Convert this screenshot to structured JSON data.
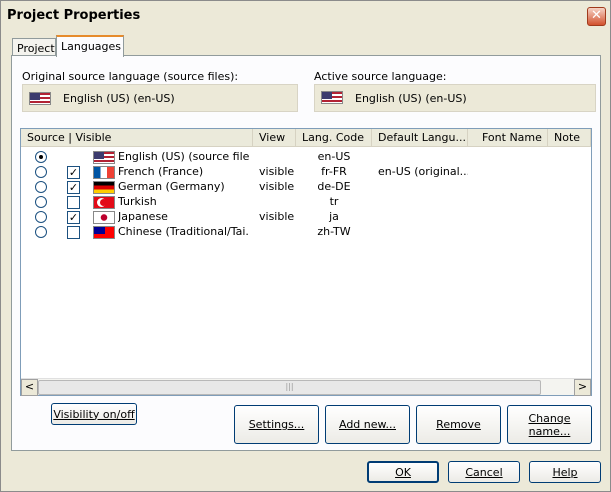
{
  "window": {
    "title": "Project Properties",
    "close": "✕"
  },
  "tabs": [
    {
      "label": "Project"
    },
    {
      "label": "Languages"
    }
  ],
  "original_source": {
    "label": "Original source language (source files):",
    "value": "English (US) (en-US)"
  },
  "active_source": {
    "label": "Active source language:",
    "value": "English (US) (en-US)"
  },
  "list": {
    "columns": [
      "Source | Visible",
      "View",
      "Lang. Code",
      "Default Langu...",
      "Font Name",
      "Note"
    ],
    "rows": [
      {
        "source_selected": true,
        "visible": null,
        "flag": "us",
        "name": "English (US) (source file)",
        "view": "",
        "code": "en-US",
        "default": ""
      },
      {
        "source_selected": false,
        "visible": true,
        "flag": "fr",
        "name": "French (France)",
        "view": "visible",
        "code": "fr-FR",
        "default": "en-US (original..."
      },
      {
        "source_selected": false,
        "visible": true,
        "flag": "de",
        "name": "German (Germany)",
        "view": "visible",
        "code": "de-DE",
        "default": ""
      },
      {
        "source_selected": false,
        "visible": false,
        "flag": "tr",
        "name": "Turkish",
        "view": "",
        "code": "tr",
        "default": ""
      },
      {
        "source_selected": false,
        "visible": true,
        "flag": "jp",
        "name": "Japanese",
        "view": "visible",
        "code": "ja",
        "default": ""
      },
      {
        "source_selected": false,
        "visible": false,
        "flag": "tw",
        "name": "Chinese (Traditional/Tai...",
        "view": "",
        "code": "zh-TW",
        "default": ""
      }
    ],
    "scroll_left": "<",
    "scroll_right": ">",
    "scroll_grip": "|||"
  },
  "buttons": {
    "visibility": "Visibility on/off",
    "settings": "Settings...",
    "add_new": "Add new...",
    "remove": "Remove",
    "change_name_1": "Change",
    "change_name_2": "name...",
    "ok": "OK",
    "cancel": "Cancel",
    "help": "Help"
  },
  "checkmark": "✓",
  "colors": {
    "tab_accent": "#e68b2c",
    "button_border": "#003c74",
    "window_bg": "#ece9d8"
  }
}
